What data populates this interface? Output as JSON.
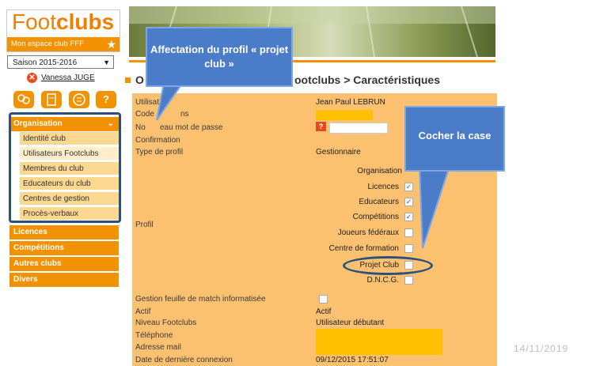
{
  "logo": {
    "foot": "Foot",
    "clubs": "clubs",
    "tagline": "Mon espace club FFF"
  },
  "season": {
    "selected": "Saison 2015-2016"
  },
  "user": {
    "name": "Vanessa JUGE"
  },
  "toolbar_icons": [
    "users-icon",
    "document-icon",
    "list-icon",
    "help-icon"
  ],
  "help_label": "?",
  "sidebar": {
    "organisation_label": "Organisation",
    "organisation_items": [
      "Identité club",
      "Utilisateurs Footclubs",
      "Membres du club",
      "Educateurs du club",
      "Centres de gestion",
      "Procès-verbaux"
    ],
    "other_sections": [
      "Licences",
      "Compétitions",
      "Autres clubs",
      "Divers"
    ]
  },
  "page": {
    "title_prefix": "O",
    "title_suffix": "ootclubs > Caractéristiques"
  },
  "callouts": {
    "profile": "Affectation du profil « projet club »",
    "check": "Cocher la case"
  },
  "form": {
    "labels": {
      "utilisateur": "Utilisate",
      "code": "Code",
      "code_tail": "ns",
      "nouveau": "No",
      "nouveau_tail": "eau mot de passe",
      "confirmation": "Confirmation",
      "type_profil": "Type de profil",
      "profil": "Profil",
      "gestion": "Gestion feuille de match informatisée",
      "actif": "Actif",
      "niveau": "Niveau Footclubs",
      "telephone": "Téléphone",
      "adresse": "Adresse mail",
      "derniere": "Date de dernière connexion"
    },
    "values": {
      "utilisateur": "Jean Paul LEBRUN",
      "type_profil": "Gestionnaire",
      "actif": "Actif",
      "niveau": "Utilisateur débutant",
      "derniere": "09/12/2015 17:51:07",
      "question_mark": "?"
    },
    "profils": [
      {
        "label": "Organisation",
        "checked": null
      },
      {
        "label": "Licences",
        "checked": true
      },
      {
        "label": "Educateurs",
        "checked": true
      },
      {
        "label": "Compétitions",
        "checked": true
      },
      {
        "label": "Joueurs fédéraux",
        "checked": false
      },
      {
        "label": "Centre de formation",
        "checked": false
      },
      {
        "label": "Projet Club",
        "checked": false
      },
      {
        "label": "D.N.C.G.",
        "checked": false
      }
    ],
    "check_mark": "✓"
  },
  "footer_date": "14/11/2019",
  "colors": {
    "orange": "#f39200",
    "panel": "#fbc070",
    "callout": "#4a7cc8",
    "highlight": "#ffc000",
    "outline": "#2d4f7c"
  }
}
